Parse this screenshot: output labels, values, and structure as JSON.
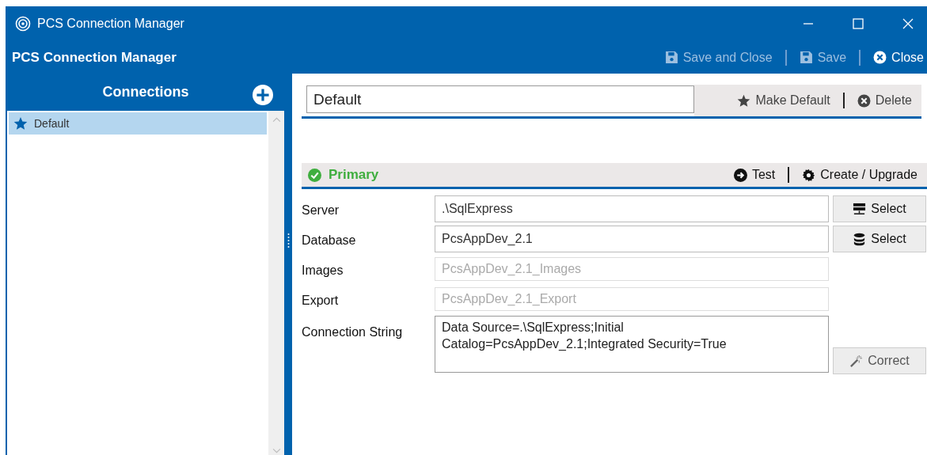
{
  "window": {
    "title": "PCS Connection Manager"
  },
  "header": {
    "title": "PCS Connection Manager",
    "actions": [
      {
        "kind": "save-close",
        "label": "Save and Close",
        "disabled": true
      },
      {
        "kind": "save",
        "label": "Save",
        "disabled": true
      },
      {
        "kind": "close",
        "label": "Close",
        "disabled": false
      }
    ]
  },
  "sidebar": {
    "title": "Connections",
    "items": [
      {
        "label": "Default",
        "selected": true,
        "is_default": true
      }
    ]
  },
  "connection": {
    "name": "Default",
    "actions": [
      {
        "kind": "star",
        "label": "Make Default"
      },
      {
        "kind": "delete",
        "label": "Delete"
      }
    ]
  },
  "section": {
    "title": "Primary",
    "valid": true,
    "actions": [
      {
        "kind": "test",
        "label": "Test"
      },
      {
        "kind": "gear",
        "label": "Create / Upgrade"
      }
    ]
  },
  "fields": [
    {
      "kind": "input",
      "label": "Server",
      "value": ".\\SqlExpress",
      "disabled": false,
      "button": {
        "kind": "server",
        "label": "Select"
      }
    },
    {
      "kind": "input",
      "label": "Database",
      "value": "PcsAppDev_2.1",
      "disabled": false,
      "button": {
        "kind": "database",
        "label": "Select"
      }
    },
    {
      "kind": "input",
      "label": "Images",
      "value": "PcsAppDev_2.1_Images",
      "disabled": true
    },
    {
      "kind": "input",
      "label": "Export",
      "value": "PcsAppDev_2.1_Export",
      "disabled": true
    },
    {
      "kind": "textarea",
      "label": "Connection String",
      "value": "Data Source=.\\SqlExpress;Initial Catalog=PcsAppDev_2.1;Integrated Security=True",
      "disabled": false,
      "button": {
        "kind": "wand",
        "label": "Correct"
      }
    }
  ]
}
